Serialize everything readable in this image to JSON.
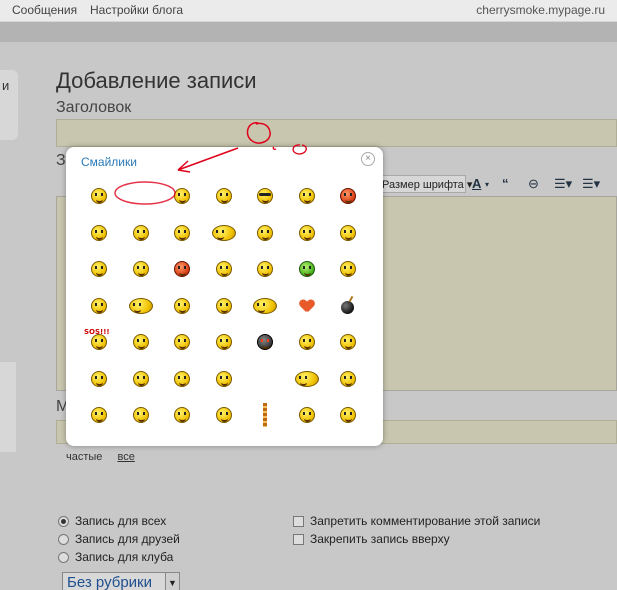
{
  "topnav": {
    "messages": "Сообщения",
    "blog_settings": "Настройки блога",
    "site": "cherrysmoke.mypage.ru"
  },
  "sidebar": {
    "partial_label": "и"
  },
  "editor": {
    "heading": "Добавление записи",
    "title_label": "Заголовок",
    "body_label_partial": "З",
    "tags_label_partial": "М",
    "toolbar": {
      "font_size": "Размер шрифта",
      "font_color": "A",
      "quote": "“",
      "link_icon": "link-icon",
      "list_bullets_icon": "bulleted-list-icon",
      "list_numbers_icon": "numbered-list-icon"
    },
    "tag_tabs": {
      "frequent": "частые",
      "all": "все"
    }
  },
  "visibility": {
    "all": "Запись для всех",
    "friends": "Запись для друзей",
    "club": "Запись для клуба",
    "selected": "all"
  },
  "options": {
    "disable_comments": "Запретить комментирование этой записи",
    "pin_top": "Закрепить запись вверху"
  },
  "category": {
    "selected": "Без рубрики"
  },
  "smileys_dialog": {
    "title": "Смайлики",
    "close_icon": "close-icon",
    "rows": [
      [
        "smile",
        "blank",
        "worried",
        "kiss",
        "cool",
        "grin",
        "blush"
      ],
      [
        "angel-hands",
        "sad",
        "scared",
        "girl-pigtails",
        "wink",
        "hands-up",
        "crazy"
      ],
      [
        "wink-small",
        "thinking",
        "devil",
        "headphones",
        "kissing",
        "green-sick",
        "neutral"
      ],
      [
        "waving",
        "girls-pair",
        "rose",
        "victory",
        "hugging",
        "heart",
        "bomb"
      ],
      [
        "sos-sign",
        "hands-clap",
        "hat",
        "lol",
        "dark-red-eyes",
        "peek",
        "dancing"
      ],
      [
        "pointing",
        "shocked",
        "surprised",
        "facepalm",
        "blank",
        "arms-wide",
        "grabbing"
      ],
      [
        "yawn",
        "nodding",
        "laughing",
        "sleepy",
        "ruler-measure",
        "music",
        "flower"
      ]
    ],
    "annotation_color": "#e0001a"
  }
}
